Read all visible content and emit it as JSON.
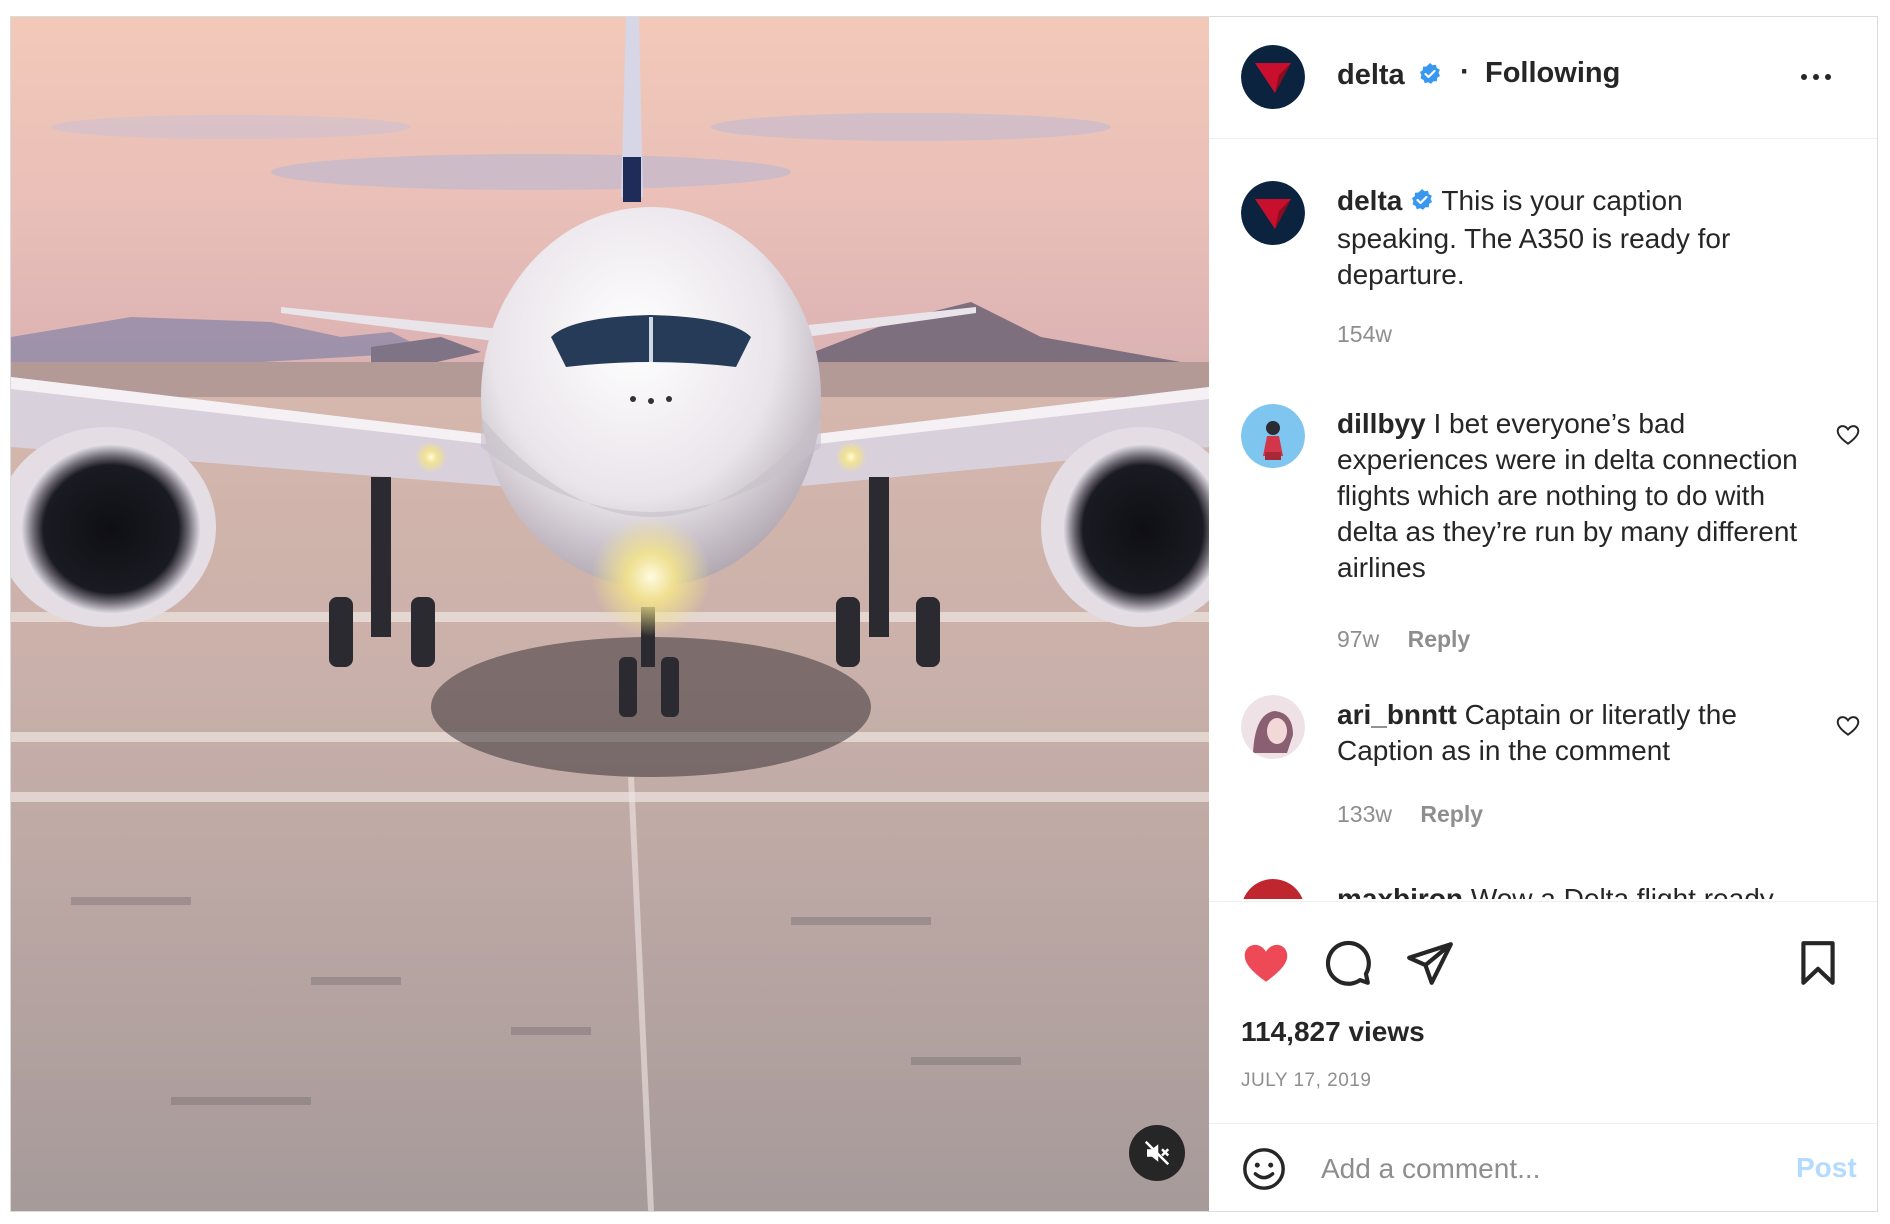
{
  "post": {
    "account": {
      "username": "delta",
      "verified": true,
      "separator": "·",
      "follow_status": "Following"
    },
    "media": {
      "type": "video",
      "muted": true,
      "mute_icon": "speaker-muted-icon"
    },
    "caption": {
      "username": "delta",
      "text": "This is your caption speaking. The A350 is ready for departure.",
      "age": "154w"
    },
    "comments": [
      {
        "username": "dillbyy",
        "text": "I bet everyone’s bad experiences were in delta connection flights which are nothing to do with delta as they’re run by many different airlines",
        "age": "97w",
        "reply_label": "Reply"
      },
      {
        "username": "ari_bnntt",
        "text": "Captain or literatly the Caption as in the comment",
        "age": "133w",
        "reply_label": "Reply"
      },
      {
        "username": "maxbiron",
        "text": "Wow a Delta flight ready",
        "partially_visible": true
      }
    ],
    "actions": {
      "liked": true,
      "icons": [
        "heart-icon",
        "comment-icon",
        "share-icon",
        "bookmark-icon"
      ]
    },
    "views": "114,827 views",
    "date": "JULY 17, 2019",
    "add_comment": {
      "placeholder": "Add a comment...",
      "post_label": "Post",
      "emoji_icon": "emoji-icon"
    }
  },
  "colors": {
    "liked_heart": "#ed4956",
    "verified_badge": "#3897f0",
    "post_button_disabled": "#b3dbff",
    "secondary_text": "#8e8e8e"
  }
}
